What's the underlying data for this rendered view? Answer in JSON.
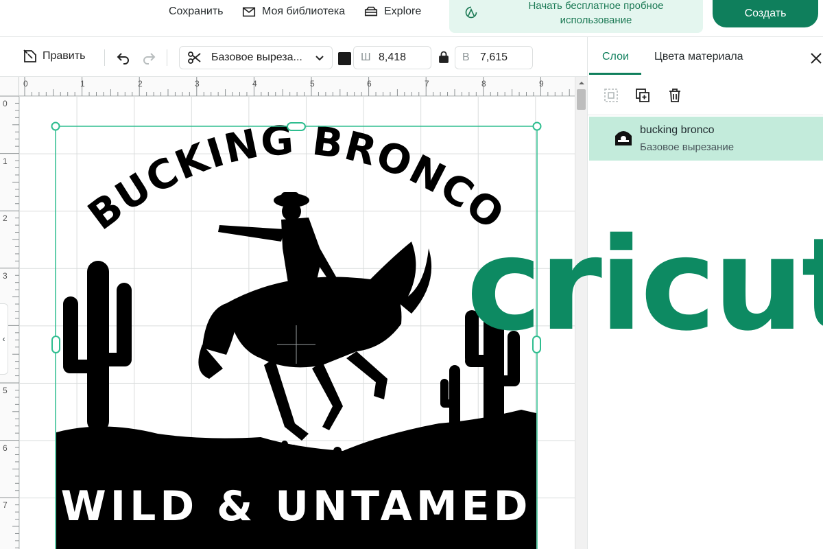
{
  "header": {
    "save_label": "Сохранить",
    "library_label": "Моя библиотека",
    "explore_label": "Explore",
    "trial_label": "Начать бесплатное пробное использование",
    "create_label": "Создать"
  },
  "toolbar": {
    "edit_label": "Править",
    "operation_label": "Базовое выреза...",
    "width_label": "Ш",
    "width_value": "8,418",
    "height_label": "В",
    "height_value": "7,615",
    "swatch_color": "#1b1b1b"
  },
  "canvas": {
    "ruler_top": [
      "0",
      "1",
      "2",
      "3",
      "4",
      "5",
      "6",
      "7",
      "8",
      "9"
    ],
    "ruler_left": [
      "0",
      "1",
      "2",
      "3",
      "4",
      "5",
      "6",
      "7"
    ],
    "design_title": "BUCKING BRONCO",
    "design_subtitle": "WILD & UNTAMED"
  },
  "panel": {
    "tab_layers": "Слои",
    "tab_colors": "Цвета материала",
    "layers": [
      {
        "name": "bucking bronco",
        "operation": "Базовое вырезание"
      }
    ]
  },
  "brand_logo": "cricut",
  "colors": {
    "accent": "#0f7f5c",
    "selection": "#2ebd8f",
    "layer_highlight": "#c3ebdb"
  }
}
